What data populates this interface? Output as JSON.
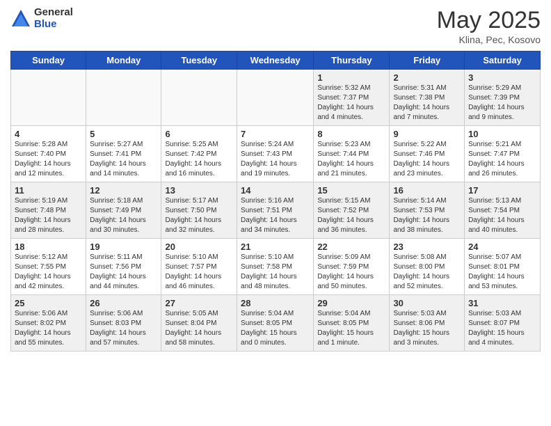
{
  "header": {
    "logo_general": "General",
    "logo_blue": "Blue",
    "title": "May 2025",
    "subtitle": "Klina, Pec, Kosovo"
  },
  "days_of_week": [
    "Sunday",
    "Monday",
    "Tuesday",
    "Wednesday",
    "Thursday",
    "Friday",
    "Saturday"
  ],
  "weeks": [
    [
      {
        "day": "",
        "empty": true
      },
      {
        "day": "",
        "empty": true
      },
      {
        "day": "",
        "empty": true
      },
      {
        "day": "",
        "empty": true
      },
      {
        "day": "1",
        "info": "Sunrise: 5:32 AM\nSunset: 7:37 PM\nDaylight: 14 hours\nand 4 minutes."
      },
      {
        "day": "2",
        "info": "Sunrise: 5:31 AM\nSunset: 7:38 PM\nDaylight: 14 hours\nand 7 minutes."
      },
      {
        "day": "3",
        "info": "Sunrise: 5:29 AM\nSunset: 7:39 PM\nDaylight: 14 hours\nand 9 minutes."
      }
    ],
    [
      {
        "day": "4",
        "info": "Sunrise: 5:28 AM\nSunset: 7:40 PM\nDaylight: 14 hours\nand 12 minutes."
      },
      {
        "day": "5",
        "info": "Sunrise: 5:27 AM\nSunset: 7:41 PM\nDaylight: 14 hours\nand 14 minutes."
      },
      {
        "day": "6",
        "info": "Sunrise: 5:25 AM\nSunset: 7:42 PM\nDaylight: 14 hours\nand 16 minutes."
      },
      {
        "day": "7",
        "info": "Sunrise: 5:24 AM\nSunset: 7:43 PM\nDaylight: 14 hours\nand 19 minutes."
      },
      {
        "day": "8",
        "info": "Sunrise: 5:23 AM\nSunset: 7:44 PM\nDaylight: 14 hours\nand 21 minutes."
      },
      {
        "day": "9",
        "info": "Sunrise: 5:22 AM\nSunset: 7:46 PM\nDaylight: 14 hours\nand 23 minutes."
      },
      {
        "day": "10",
        "info": "Sunrise: 5:21 AM\nSunset: 7:47 PM\nDaylight: 14 hours\nand 26 minutes."
      }
    ],
    [
      {
        "day": "11",
        "info": "Sunrise: 5:19 AM\nSunset: 7:48 PM\nDaylight: 14 hours\nand 28 minutes."
      },
      {
        "day": "12",
        "info": "Sunrise: 5:18 AM\nSunset: 7:49 PM\nDaylight: 14 hours\nand 30 minutes."
      },
      {
        "day": "13",
        "info": "Sunrise: 5:17 AM\nSunset: 7:50 PM\nDaylight: 14 hours\nand 32 minutes."
      },
      {
        "day": "14",
        "info": "Sunrise: 5:16 AM\nSunset: 7:51 PM\nDaylight: 14 hours\nand 34 minutes."
      },
      {
        "day": "15",
        "info": "Sunrise: 5:15 AM\nSunset: 7:52 PM\nDaylight: 14 hours\nand 36 minutes."
      },
      {
        "day": "16",
        "info": "Sunrise: 5:14 AM\nSunset: 7:53 PM\nDaylight: 14 hours\nand 38 minutes."
      },
      {
        "day": "17",
        "info": "Sunrise: 5:13 AM\nSunset: 7:54 PM\nDaylight: 14 hours\nand 40 minutes."
      }
    ],
    [
      {
        "day": "18",
        "info": "Sunrise: 5:12 AM\nSunset: 7:55 PM\nDaylight: 14 hours\nand 42 minutes."
      },
      {
        "day": "19",
        "info": "Sunrise: 5:11 AM\nSunset: 7:56 PM\nDaylight: 14 hours\nand 44 minutes."
      },
      {
        "day": "20",
        "info": "Sunrise: 5:10 AM\nSunset: 7:57 PM\nDaylight: 14 hours\nand 46 minutes."
      },
      {
        "day": "21",
        "info": "Sunrise: 5:10 AM\nSunset: 7:58 PM\nDaylight: 14 hours\nand 48 minutes."
      },
      {
        "day": "22",
        "info": "Sunrise: 5:09 AM\nSunset: 7:59 PM\nDaylight: 14 hours\nand 50 minutes."
      },
      {
        "day": "23",
        "info": "Sunrise: 5:08 AM\nSunset: 8:00 PM\nDaylight: 14 hours\nand 52 minutes."
      },
      {
        "day": "24",
        "info": "Sunrise: 5:07 AM\nSunset: 8:01 PM\nDaylight: 14 hours\nand 53 minutes."
      }
    ],
    [
      {
        "day": "25",
        "info": "Sunrise: 5:06 AM\nSunset: 8:02 PM\nDaylight: 14 hours\nand 55 minutes."
      },
      {
        "day": "26",
        "info": "Sunrise: 5:06 AM\nSunset: 8:03 PM\nDaylight: 14 hours\nand 57 minutes."
      },
      {
        "day": "27",
        "info": "Sunrise: 5:05 AM\nSunset: 8:04 PM\nDaylight: 14 hours\nand 58 minutes."
      },
      {
        "day": "28",
        "info": "Sunrise: 5:04 AM\nSunset: 8:05 PM\nDaylight: 15 hours\nand 0 minutes."
      },
      {
        "day": "29",
        "info": "Sunrise: 5:04 AM\nSunset: 8:05 PM\nDaylight: 15 hours\nand 1 minute."
      },
      {
        "day": "30",
        "info": "Sunrise: 5:03 AM\nSunset: 8:06 PM\nDaylight: 15 hours\nand 3 minutes."
      },
      {
        "day": "31",
        "info": "Sunrise: 5:03 AM\nSunset: 8:07 PM\nDaylight: 15 hours\nand 4 minutes."
      }
    ]
  ]
}
